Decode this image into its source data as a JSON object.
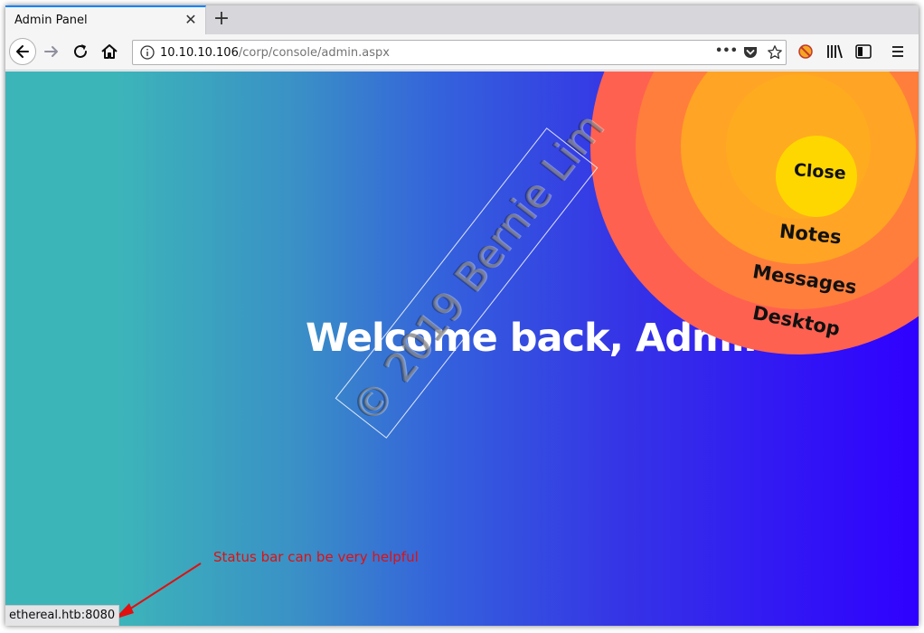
{
  "browser": {
    "tab": {
      "title": "Admin Panel",
      "close_glyph": "✕"
    },
    "new_tab_glyph": "+",
    "url": {
      "host": "10.10.10.106",
      "path": "/corp/console/admin.aspx"
    },
    "page_actions_glyph": "•••",
    "icons": [
      "back-icon",
      "forward-icon",
      "reload-icon",
      "home-icon",
      "site-info-icon",
      "pocket-icon",
      "bookmark-star-icon",
      "extension-icon",
      "library-icon",
      "sidebar-icon",
      "menu-icon"
    ]
  },
  "page": {
    "welcome": "Welcome back, Admin",
    "menu": {
      "close": "Close",
      "notes": "Notes",
      "messages": "Messages",
      "desktop": "Desktop"
    },
    "watermark": "© 2019 Bernie Lim"
  },
  "statusbar": {
    "text": "ethereal.htb:8080"
  },
  "annotation": {
    "text": "Status bar can be very helpful"
  },
  "colors": {
    "gradient_start": "#3cb5b9",
    "gradient_end": "#2f00ff",
    "ring_outer": "#ff6150",
    "ring_2": "#ff7e3c",
    "ring_3": "#ff9a2a",
    "ring_4": "#ffa91f",
    "close_center": "#ffd700",
    "annotation": "#e01010"
  }
}
